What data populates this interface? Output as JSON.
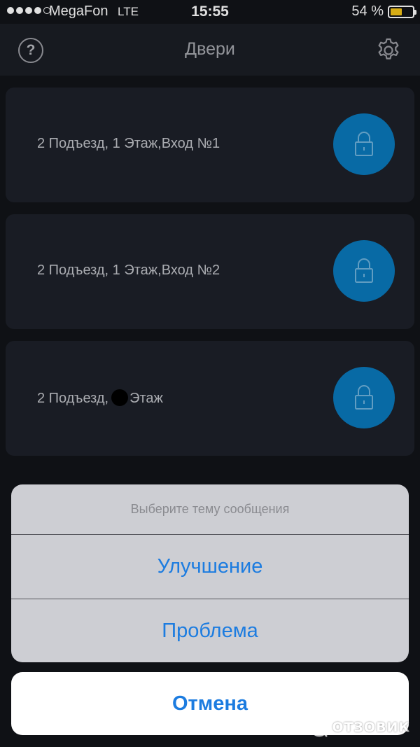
{
  "status_bar": {
    "carrier": "MegaFon",
    "network": "LTE",
    "time": "15:55",
    "battery_percent_text": "54 %",
    "battery_level": 0.54,
    "signal_bars_filled": 4,
    "signal_bars_total": 5,
    "battery_color": "#f5c518"
  },
  "nav": {
    "title": "Двери",
    "help_glyph": "?",
    "left_icon": "help-icon",
    "right_icon": "gear-icon"
  },
  "doors": [
    {
      "label": "2 Подъезд, 1 Этаж,Вход №1",
      "icon": "lock-icon"
    },
    {
      "label": "2 Подъезд, 1 Этаж,Вход №2",
      "icon": "lock-icon"
    },
    {
      "label_before": "2 Подъезд,",
      "label_after": "Этаж",
      "icon": "lock-icon"
    }
  ],
  "action_sheet": {
    "title": "Выберите тему сообщения",
    "options": [
      "Улучшение",
      "Проблема"
    ],
    "cancel": "Отмена"
  },
  "watermark": {
    "text": "ОТЗОВИК",
    "icon": "otzovik-logo-icon"
  },
  "colors": {
    "accent": "#1c7ce0",
    "lock_button": "#0a79bc",
    "background": "#121419",
    "card": "#1d2029"
  }
}
